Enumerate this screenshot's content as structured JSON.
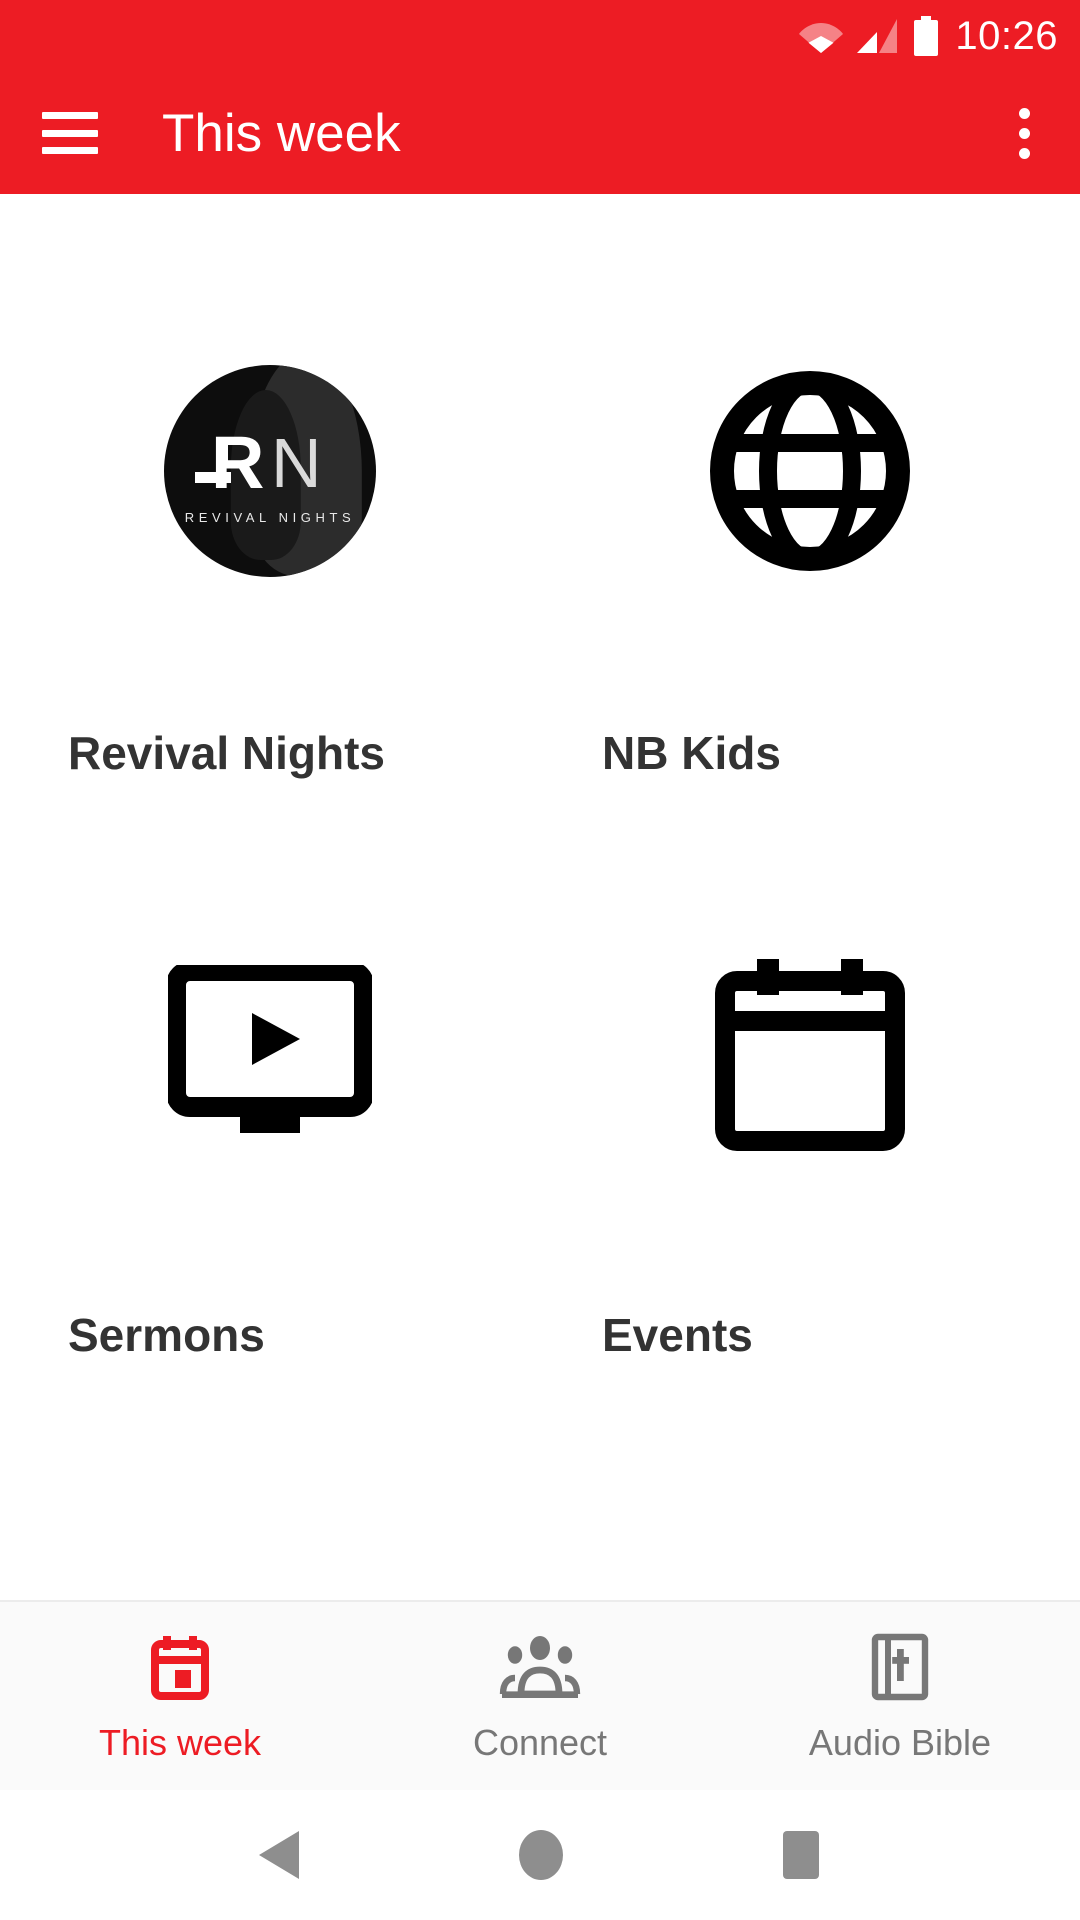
{
  "status_bar": {
    "time": "10:26",
    "icons": [
      "wifi-icon",
      "cellular-signal-icon",
      "battery-full-icon"
    ]
  },
  "app_bar": {
    "title": "This week",
    "menu_icon": "hamburger-menu-icon",
    "overflow_icon": "overflow-menu-icon"
  },
  "colors": {
    "brand_red": "#ED1C24",
    "label_dark": "#333333",
    "inactive_gray": "#777777",
    "icon_black": "#000000",
    "surface": "#ffffff",
    "tabbar_bg": "#fafafa"
  },
  "grid_tiles": [
    {
      "label": "Revival Nights",
      "icon": "revival-nights-logo",
      "logo_text": "RN",
      "logo_subtext": "REVIVAL NIGHTS"
    },
    {
      "label": "NB Kids",
      "icon": "globe-icon"
    },
    {
      "label": "Sermons",
      "icon": "tv-play-icon"
    },
    {
      "label": "Events",
      "icon": "calendar-icon"
    }
  ],
  "bottom_tabs": [
    {
      "label": "This week",
      "icon": "calendar-today-icon",
      "active": true
    },
    {
      "label": "Connect",
      "icon": "people-group-icon",
      "active": false
    },
    {
      "label": "Audio Bible",
      "icon": "bible-book-icon",
      "active": false
    }
  ],
  "android_nav": [
    {
      "name": "back-button",
      "icon": "triangle-back-icon"
    },
    {
      "name": "home-button",
      "icon": "circle-home-icon"
    },
    {
      "name": "recents-button",
      "icon": "square-recents-icon"
    }
  ]
}
